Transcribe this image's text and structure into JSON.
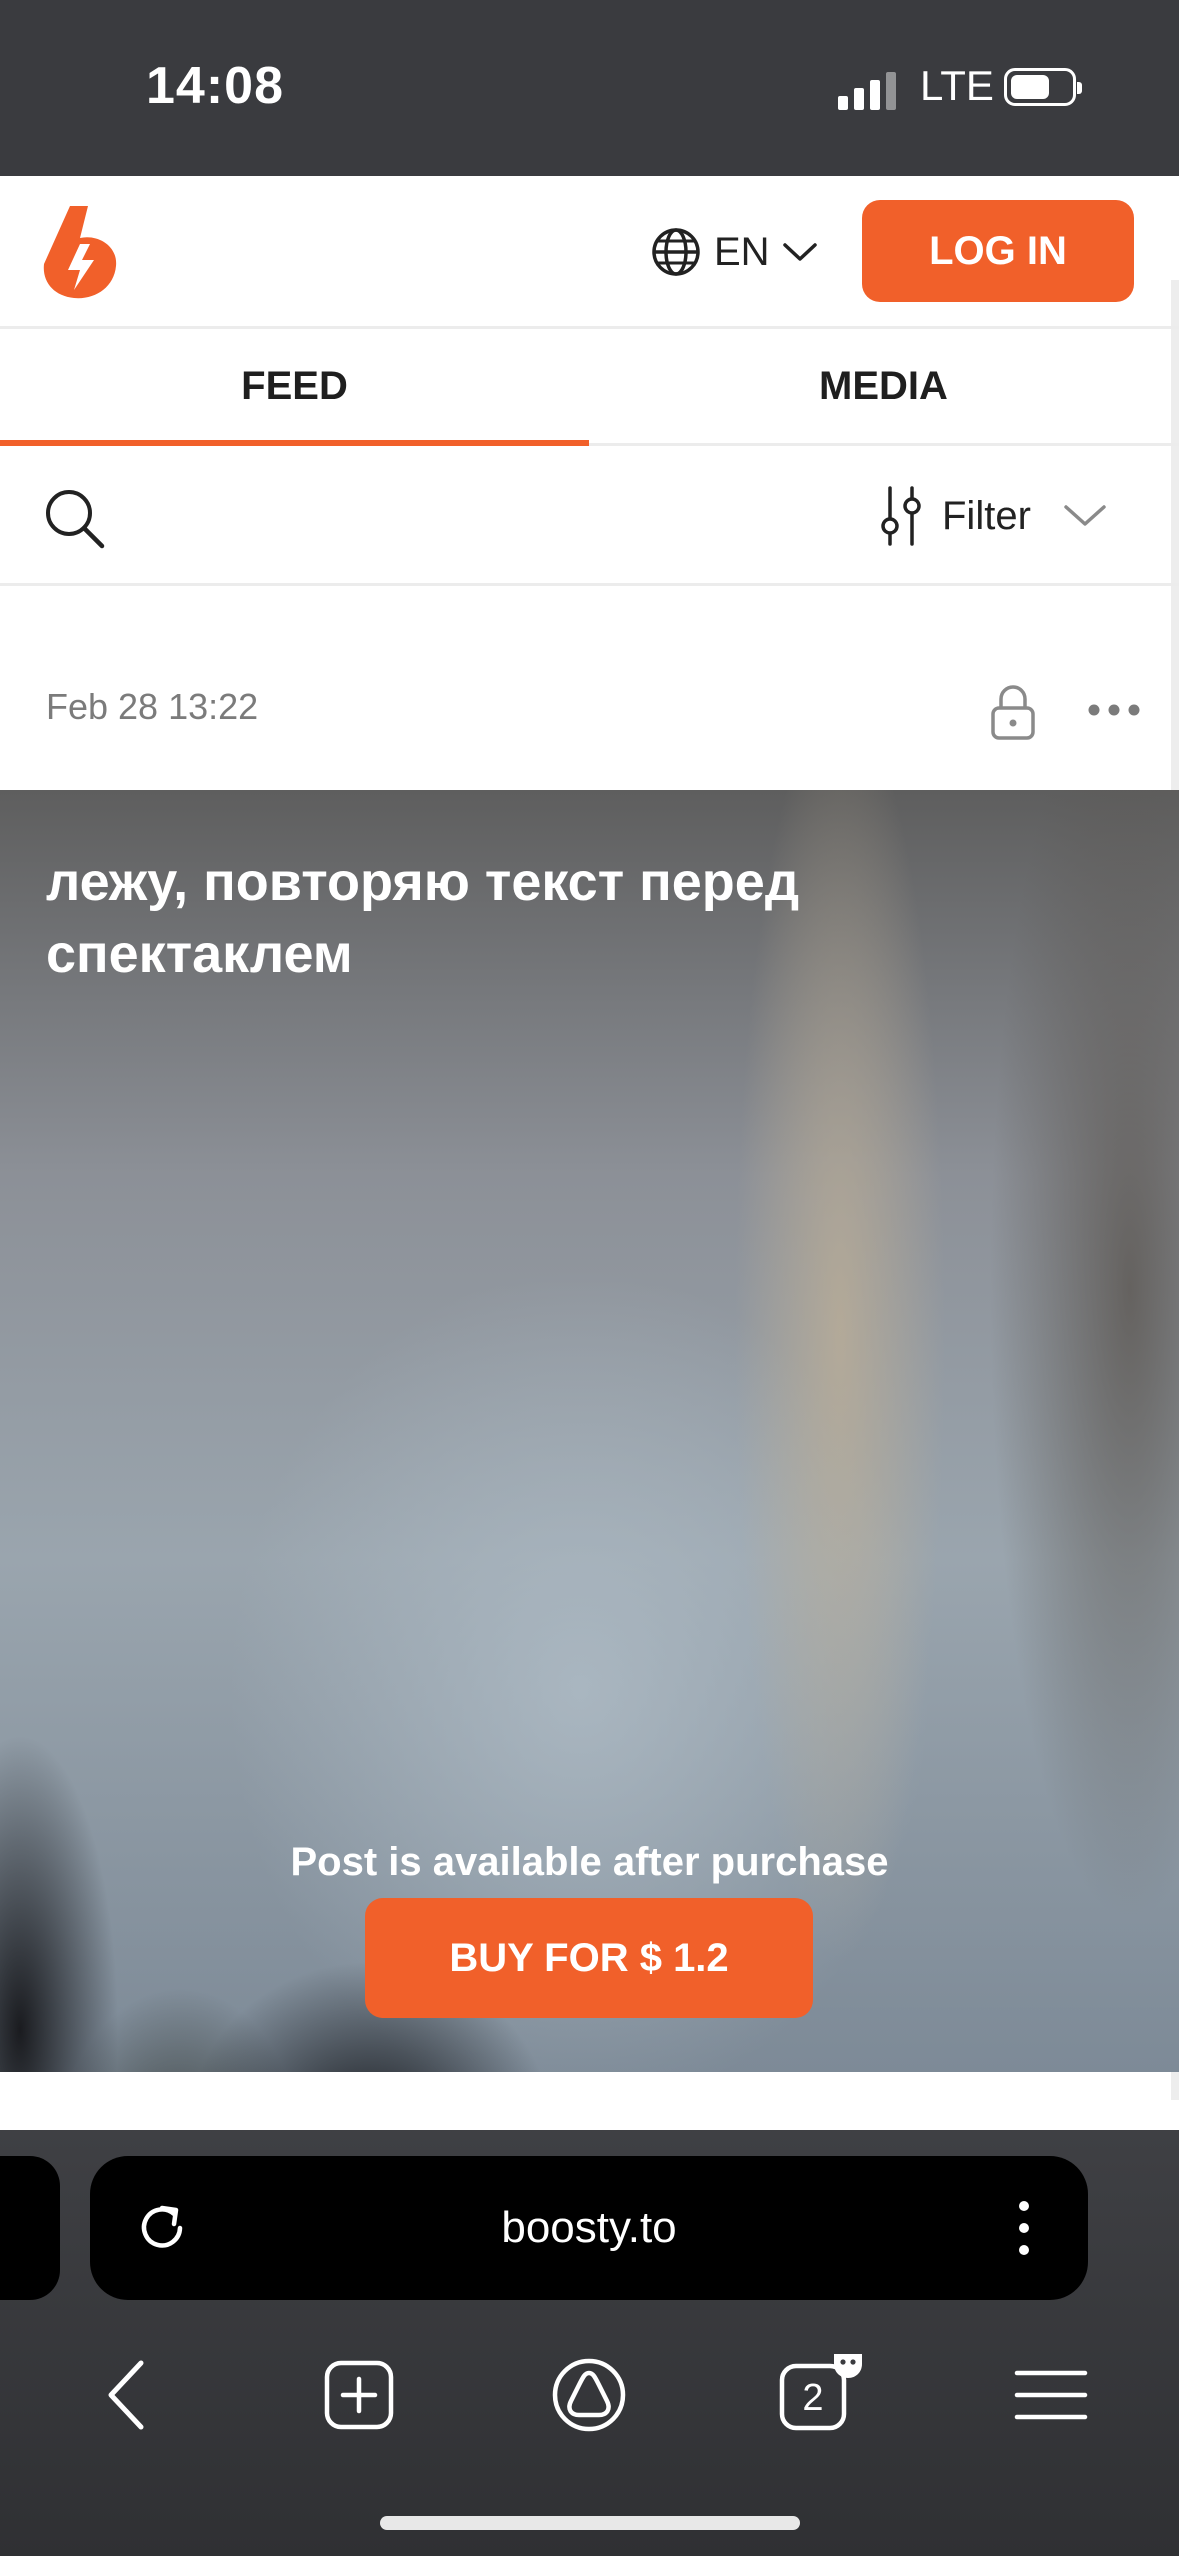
{
  "status_bar": {
    "time": "14:08",
    "network": "LTE"
  },
  "header": {
    "logo": "boosty-logo",
    "language": "EN",
    "login_label": "LOG IN"
  },
  "tabs": [
    {
      "label": "FEED",
      "active": true
    },
    {
      "label": "MEDIA",
      "active": false
    }
  ],
  "searchbar": {
    "filter_label": "Filter"
  },
  "post": {
    "date": "Feb 28 13:22",
    "title": "лежу, повторяю текст перед спектаклем",
    "locked_text": "Post is available after purchase",
    "buy_label": "BUY FOR $ 1.2"
  },
  "browser": {
    "url": "boosty.to",
    "tab_count": "2"
  },
  "colors": {
    "accent": "#f1602a",
    "chrome_bg": "#3a3b3f",
    "text_muted": "#7b7b7b"
  }
}
